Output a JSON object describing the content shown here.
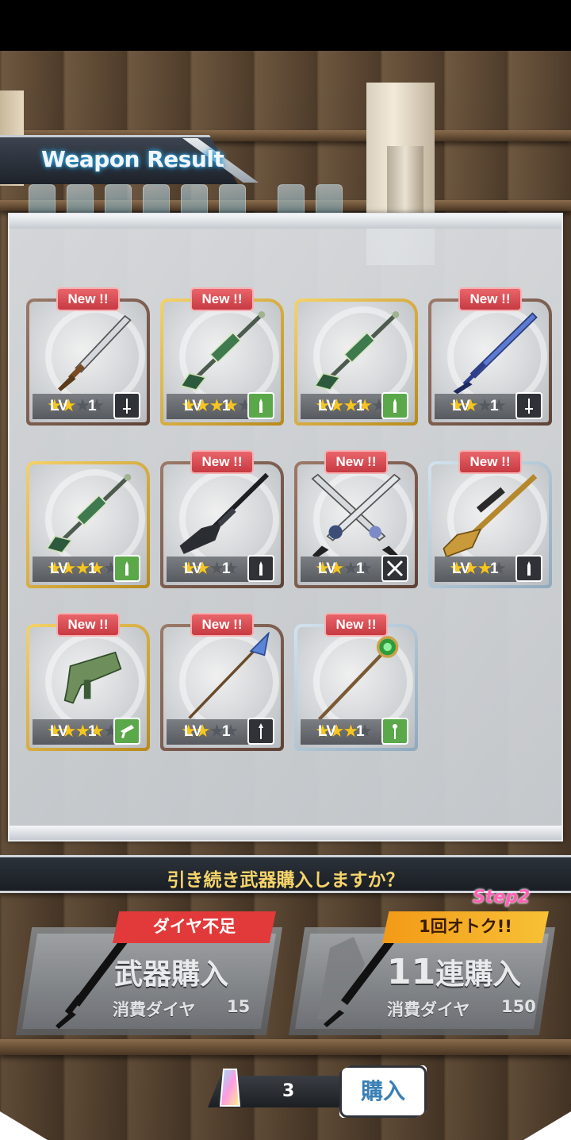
{
  "title": "Weapon Result",
  "prompt": "引き続き武器購入しますか？",
  "weapons": [
    {
      "new": "New !!",
      "stars": 2,
      "max_stars": 4,
      "lv_label": "LV",
      "level": "1",
      "weapon_icon": "dagger-icon",
      "type_icon": "melee-sword-icon",
      "rarity_color": "#7a5a4a"
    },
    {
      "new": "New !!",
      "stars": 4,
      "max_stars": 5,
      "lv_label": "LV",
      "level": "1",
      "weapon_icon": "sniper-rifle-icon",
      "type_icon": "bullet-icon",
      "rarity_color": "#e0b03a"
    },
    {
      "new": "",
      "stars": 4,
      "max_stars": 5,
      "lv_label": "LV",
      "level": "1",
      "weapon_icon": "sniper-rifle-icon",
      "type_icon": "bullet-icon",
      "rarity_color": "#e0b03a"
    },
    {
      "new": "New !!",
      "stars": 2,
      "max_stars": 4,
      "lv_label": "LV",
      "level": "1",
      "weapon_icon": "sword-icon",
      "type_icon": "melee-sword-icon",
      "rarity_color": "#7a5a4a"
    },
    {
      "new": "",
      "stars": 4,
      "max_stars": 5,
      "lv_label": "LV",
      "level": "1",
      "weapon_icon": "sniper-rifle-icon",
      "type_icon": "bullet-icon",
      "rarity_color": "#e0b03a"
    },
    {
      "new": "New !!",
      "stars": 2,
      "max_stars": 4,
      "lv_label": "LV",
      "level": "1",
      "weapon_icon": "rifle-icon",
      "type_icon": "bullet-icon",
      "rarity_color": "#7a5a4a"
    },
    {
      "new": "New !!",
      "stars": 2,
      "max_stars": 4,
      "lv_label": "LV",
      "level": "1",
      "weapon_icon": "dual-swords-icon",
      "type_icon": "crossed-swords-icon",
      "rarity_color": "#7a5a4a"
    },
    {
      "new": "New !!",
      "stars": 3,
      "max_stars": 4,
      "lv_label": "LV",
      "level": "1",
      "weapon_icon": "golden-rifle-icon",
      "type_icon": "bullet-icon",
      "rarity_color": "#b8cfe0"
    },
    {
      "new": "New !!",
      "stars": 4,
      "max_stars": 5,
      "lv_label": "LV",
      "level": "1",
      "weapon_icon": "submachine-gun-icon",
      "type_icon": "smg-icon",
      "rarity_color": "#e0b03a"
    },
    {
      "new": "New !!",
      "stars": 2,
      "max_stars": 4,
      "lv_label": "LV",
      "level": "1",
      "weapon_icon": "spear-icon",
      "type_icon": "spear-type-icon",
      "rarity_color": "#7a5a4a"
    },
    {
      "new": "New !!",
      "stars": 3,
      "max_stars": 4,
      "lv_label": "LV",
      "level": "1",
      "weapon_icon": "staff-icon",
      "type_icon": "staff-type-icon",
      "rarity_color": "#b8cfe0"
    }
  ],
  "single_buy": {
    "tag": "ダイヤ不足",
    "label": "武器購入",
    "cost_label": "消費ダイヤ",
    "cost": "15"
  },
  "multi_buy": {
    "step": "Step2",
    "tag": "1回オトク!!",
    "label_num": "11",
    "label": "連購入",
    "cost_label": "消費ダイヤ",
    "cost": "150"
  },
  "ticket": {
    "count": "3",
    "buy_label": "購入"
  },
  "colors": {
    "new_badge": "#d9474e",
    "star": "#f5c623",
    "gun_type": "#5ba84a",
    "prompt_text": "#f5d46a",
    "shortage_tag": "#e23a3a",
    "deal_tag": "#f4a31e",
    "step_label": "#ff5fb4"
  }
}
